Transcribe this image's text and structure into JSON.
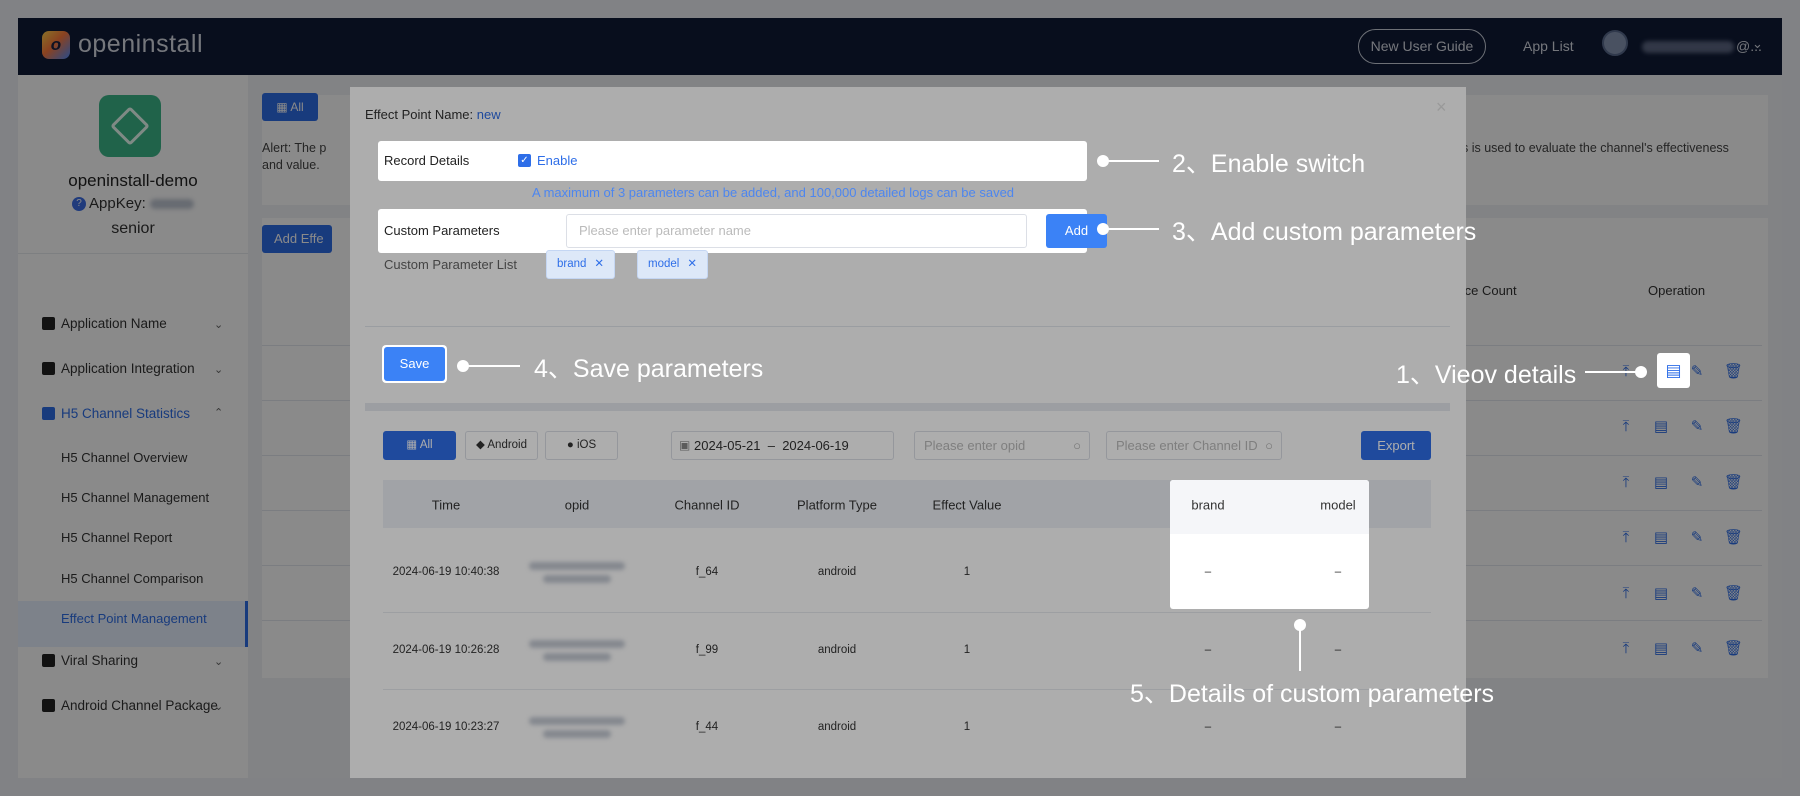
{
  "topnav": {
    "logo_text": "openinstall",
    "new_user_guide": "New User Guide",
    "app_list": "App List",
    "user_suffix": "@..."
  },
  "sidebar": {
    "app_name": "openinstall-demo",
    "appkey_label": "AppKey:",
    "level": "senior",
    "menu": [
      {
        "label": "Application Name"
      },
      {
        "label": "Application Integration"
      },
      {
        "label": "H5 Channel Statistics"
      },
      {
        "label": "Viral Sharing"
      },
      {
        "label": "Android Channel Package"
      }
    ],
    "submenu": [
      {
        "label": "H5 Channel Overview"
      },
      {
        "label": "H5 Channel Management"
      },
      {
        "label": "H5 Channel Report"
      },
      {
        "label": "H5 Channel Comparison"
      },
      {
        "label": "Effect Point Management"
      }
    ]
  },
  "background": {
    "all_label": "All",
    "alert_left": "Alert: The p",
    "alert_left2": "and value.",
    "alert_right": "s is used to evaluate the channel's effectiveness",
    "add_effect": "Add Effe",
    "col_device_count": "evice Count",
    "col_operation": "Operation"
  },
  "modal": {
    "title_label": "Effect Point Name: ",
    "title_value": "new",
    "record_details_label": "Record Details",
    "enable_label": "Enable",
    "hint": "A maximum of 3 parameters can be added, and 100,000 detailed logs can be saved",
    "custom_params_label": "Custom Parameters",
    "param_placeholder": "Please enter parameter name",
    "add_label": "Add",
    "param_list_label": "Custom Parameter List",
    "param_tags": [
      "brand",
      "model"
    ],
    "save_label": "Save",
    "filters": {
      "all": "All",
      "android": "Android",
      "ios": "iOS",
      "date_from": "2024-05-21",
      "date_sep": "–",
      "date_to": "2024-06-19",
      "opid_placeholder": "Please enter opid",
      "channel_placeholder": "Please enter Channel ID",
      "export": "Export"
    },
    "table": {
      "headers": [
        "Time",
        "opid",
        "Channel ID",
        "Platform Type",
        "Effect Value",
        "brand",
        "model"
      ],
      "rows": [
        {
          "time": "2024-06-19 10:40:38",
          "channel": "f_64",
          "platform": "android",
          "value": "1",
          "brand": "–",
          "model": "–"
        },
        {
          "time": "2024-06-19 10:26:28",
          "channel": "f_99",
          "platform": "android",
          "value": "1",
          "brand": "–",
          "model": "–"
        },
        {
          "time": "2024-06-19 10:23:27",
          "channel": "f_44",
          "platform": "android",
          "value": "1",
          "brand": "–",
          "model": "–"
        }
      ]
    }
  },
  "annotations": {
    "a1": "1、Vieov details",
    "a2": "2、Enable switch",
    "a3": "3、Add custom parameters",
    "a4": "4、Save parameters",
    "a5": "5、Details of custom parameters"
  }
}
